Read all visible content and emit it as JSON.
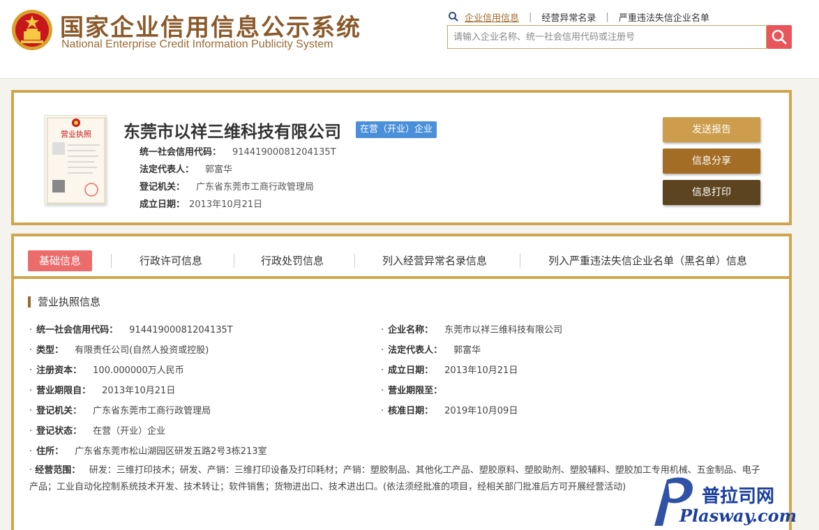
{
  "header": {
    "title_cn": "国家企业信用信息公示系统",
    "title_en": "National Enterprise Credit Information Publicity System",
    "nav": [
      {
        "label": "企业信用信息",
        "active": true
      },
      {
        "label": "经营异常名录",
        "active": false
      },
      {
        "label": "严重违法失信企业名单",
        "active": false
      }
    ],
    "search_placeholder": "请输入企业名称、统一社会信用代码或注册号"
  },
  "company": {
    "name": "东莞市以祥三维科技有限公司",
    "status": "在营（开业）企业",
    "credit_code_label": "统一社会信用代码：",
    "credit_code": "91441900081204135T",
    "legal_rep_label": "法定代表人：",
    "legal_rep": "郭富华",
    "authority_label": "登记机关：",
    "authority": "广东省东莞市工商行政管理局",
    "founded_label": "成立日期：",
    "founded": "2013年10月21日",
    "license_text": "营业执照",
    "actions": {
      "report": "发送报告",
      "share": "信息分享",
      "print": "信息打印"
    }
  },
  "tabs": [
    "基础信息",
    "行政许可信息",
    "行政处罚信息",
    "列入经营异常名录信息",
    "列入严重违法失信企业名单（黑名单）信息"
  ],
  "license_section": {
    "title": "营业执照信息",
    "fields": {
      "credit_code": {
        "label": "统一社会信用代码：",
        "value": "91441900081204135T"
      },
      "name": {
        "label": "企业名称：",
        "value": "东莞市以祥三维科技有限公司"
      },
      "type": {
        "label": "类型：",
        "value": "有限责任公司(自然人投资或控股)"
      },
      "legal_rep": {
        "label": "法定代表人：",
        "value": "郭富华"
      },
      "capital": {
        "label": "注册资本：",
        "value": "100.000000万人民币"
      },
      "founded": {
        "label": "成立日期：",
        "value": "2013年10月21日"
      },
      "term_from": {
        "label": "营业期限自：",
        "value": "2013年10月21日"
      },
      "term_to": {
        "label": "营业期限至：",
        "value": ""
      },
      "authority": {
        "label": "登记机关：",
        "value": "广东省东莞市工商行政管理局"
      },
      "approved": {
        "label": "核准日期：",
        "value": "2019年10月09日"
      },
      "status": {
        "label": "登记状态：",
        "value": "在营（开业）企业"
      },
      "address": {
        "label": "住所：",
        "value": "广东省东莞市松山湖园区研发五路2号3栋213室"
      },
      "scope_label": "经营范围：",
      "scope": "研发：三维打印技术；研发、产销：三维打印设备及打印耗材；产销：塑胶制品、其他化工产品、塑胶原料、塑胶助剂、塑胶辅料、塑胶加工专用机械、五金制品、电子产品；工业自动化控制系统技术开发、技术转让；软件销售；货物进出口、技术进出口。(依法须经批准的项目，经相关部门批准后方可开展经营活动)"
    }
  },
  "watermark": {
    "line1": "普拉司网",
    "line2": "Plasway.com"
  },
  "colors": {
    "gold": "#cfa64f",
    "brown": "#8b5a2b",
    "badge_blue": "#4a8fd9",
    "tab_red": "#ec6b6b",
    "search_red": "#e8555a"
  }
}
